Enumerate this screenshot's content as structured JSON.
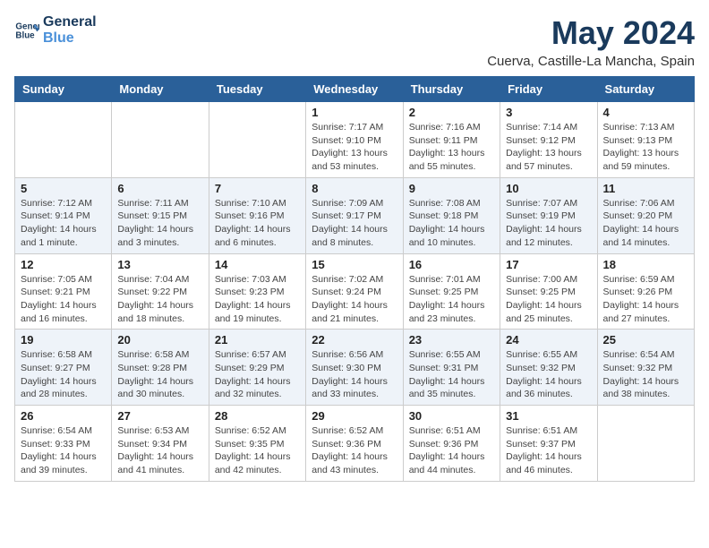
{
  "header": {
    "logo_line1": "General",
    "logo_line2": "Blue",
    "month": "May 2024",
    "location": "Cuerva, Castille-La Mancha, Spain"
  },
  "days_of_week": [
    "Sunday",
    "Monday",
    "Tuesday",
    "Wednesday",
    "Thursday",
    "Friday",
    "Saturday"
  ],
  "weeks": [
    [
      {
        "day": "",
        "info": ""
      },
      {
        "day": "",
        "info": ""
      },
      {
        "day": "",
        "info": ""
      },
      {
        "day": "1",
        "info": "Sunrise: 7:17 AM\nSunset: 9:10 PM\nDaylight: 13 hours and 53 minutes."
      },
      {
        "day": "2",
        "info": "Sunrise: 7:16 AM\nSunset: 9:11 PM\nDaylight: 13 hours and 55 minutes."
      },
      {
        "day": "3",
        "info": "Sunrise: 7:14 AM\nSunset: 9:12 PM\nDaylight: 13 hours and 57 minutes."
      },
      {
        "day": "4",
        "info": "Sunrise: 7:13 AM\nSunset: 9:13 PM\nDaylight: 13 hours and 59 minutes."
      }
    ],
    [
      {
        "day": "5",
        "info": "Sunrise: 7:12 AM\nSunset: 9:14 PM\nDaylight: 14 hours and 1 minute."
      },
      {
        "day": "6",
        "info": "Sunrise: 7:11 AM\nSunset: 9:15 PM\nDaylight: 14 hours and 3 minutes."
      },
      {
        "day": "7",
        "info": "Sunrise: 7:10 AM\nSunset: 9:16 PM\nDaylight: 14 hours and 6 minutes."
      },
      {
        "day": "8",
        "info": "Sunrise: 7:09 AM\nSunset: 9:17 PM\nDaylight: 14 hours and 8 minutes."
      },
      {
        "day": "9",
        "info": "Sunrise: 7:08 AM\nSunset: 9:18 PM\nDaylight: 14 hours and 10 minutes."
      },
      {
        "day": "10",
        "info": "Sunrise: 7:07 AM\nSunset: 9:19 PM\nDaylight: 14 hours and 12 minutes."
      },
      {
        "day": "11",
        "info": "Sunrise: 7:06 AM\nSunset: 9:20 PM\nDaylight: 14 hours and 14 minutes."
      }
    ],
    [
      {
        "day": "12",
        "info": "Sunrise: 7:05 AM\nSunset: 9:21 PM\nDaylight: 14 hours and 16 minutes."
      },
      {
        "day": "13",
        "info": "Sunrise: 7:04 AM\nSunset: 9:22 PM\nDaylight: 14 hours and 18 minutes."
      },
      {
        "day": "14",
        "info": "Sunrise: 7:03 AM\nSunset: 9:23 PM\nDaylight: 14 hours and 19 minutes."
      },
      {
        "day": "15",
        "info": "Sunrise: 7:02 AM\nSunset: 9:24 PM\nDaylight: 14 hours and 21 minutes."
      },
      {
        "day": "16",
        "info": "Sunrise: 7:01 AM\nSunset: 9:25 PM\nDaylight: 14 hours and 23 minutes."
      },
      {
        "day": "17",
        "info": "Sunrise: 7:00 AM\nSunset: 9:25 PM\nDaylight: 14 hours and 25 minutes."
      },
      {
        "day": "18",
        "info": "Sunrise: 6:59 AM\nSunset: 9:26 PM\nDaylight: 14 hours and 27 minutes."
      }
    ],
    [
      {
        "day": "19",
        "info": "Sunrise: 6:58 AM\nSunset: 9:27 PM\nDaylight: 14 hours and 28 minutes."
      },
      {
        "day": "20",
        "info": "Sunrise: 6:58 AM\nSunset: 9:28 PM\nDaylight: 14 hours and 30 minutes."
      },
      {
        "day": "21",
        "info": "Sunrise: 6:57 AM\nSunset: 9:29 PM\nDaylight: 14 hours and 32 minutes."
      },
      {
        "day": "22",
        "info": "Sunrise: 6:56 AM\nSunset: 9:30 PM\nDaylight: 14 hours and 33 minutes."
      },
      {
        "day": "23",
        "info": "Sunrise: 6:55 AM\nSunset: 9:31 PM\nDaylight: 14 hours and 35 minutes."
      },
      {
        "day": "24",
        "info": "Sunrise: 6:55 AM\nSunset: 9:32 PM\nDaylight: 14 hours and 36 minutes."
      },
      {
        "day": "25",
        "info": "Sunrise: 6:54 AM\nSunset: 9:32 PM\nDaylight: 14 hours and 38 minutes."
      }
    ],
    [
      {
        "day": "26",
        "info": "Sunrise: 6:54 AM\nSunset: 9:33 PM\nDaylight: 14 hours and 39 minutes."
      },
      {
        "day": "27",
        "info": "Sunrise: 6:53 AM\nSunset: 9:34 PM\nDaylight: 14 hours and 41 minutes."
      },
      {
        "day": "28",
        "info": "Sunrise: 6:52 AM\nSunset: 9:35 PM\nDaylight: 14 hours and 42 minutes."
      },
      {
        "day": "29",
        "info": "Sunrise: 6:52 AM\nSunset: 9:36 PM\nDaylight: 14 hours and 43 minutes."
      },
      {
        "day": "30",
        "info": "Sunrise: 6:51 AM\nSunset: 9:36 PM\nDaylight: 14 hours and 44 minutes."
      },
      {
        "day": "31",
        "info": "Sunrise: 6:51 AM\nSunset: 9:37 PM\nDaylight: 14 hours and 46 minutes."
      },
      {
        "day": "",
        "info": ""
      }
    ]
  ]
}
